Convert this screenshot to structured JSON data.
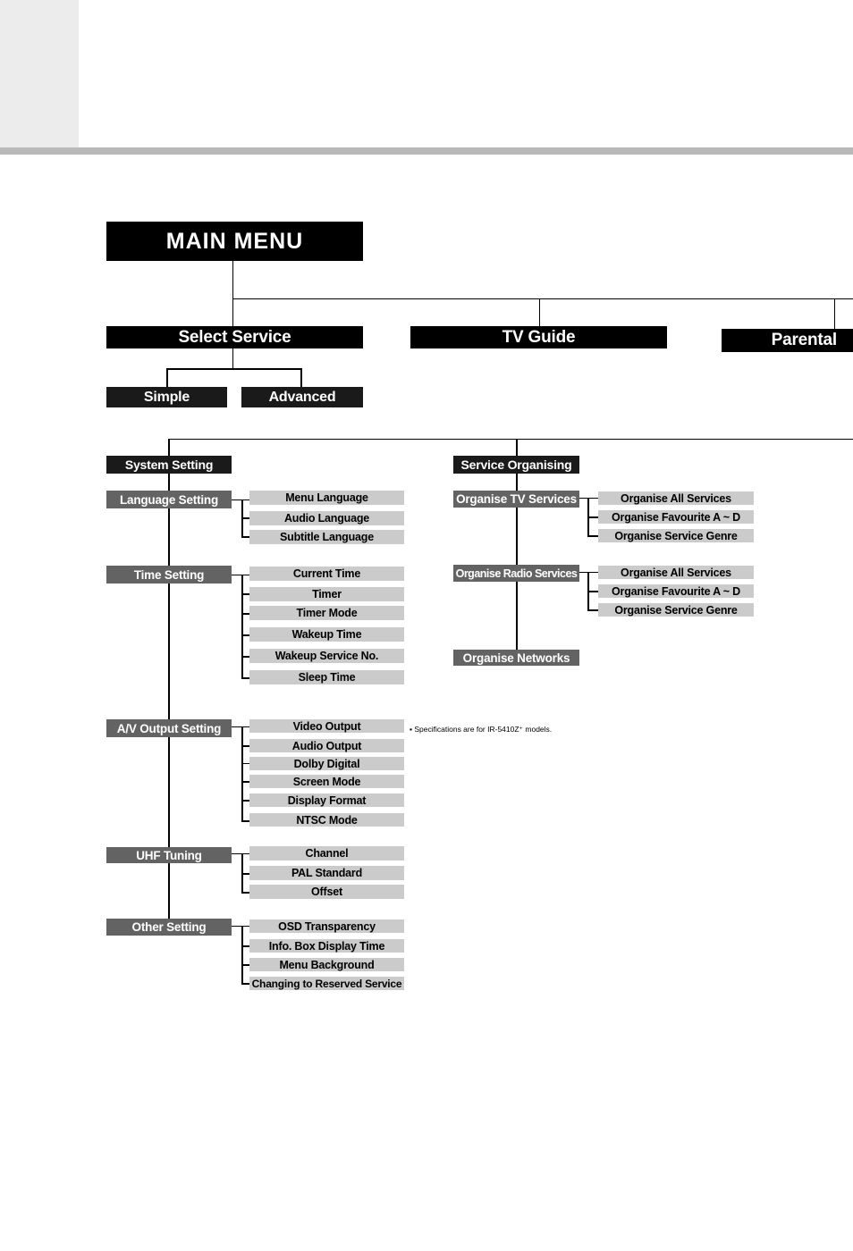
{
  "page": {
    "note": "▪ Specifications are for IR-5410Z⁺ models."
  },
  "tree": {
    "root": "MAIN MENU",
    "top_level": [
      {
        "label": "Select Service",
        "children": [
          "Simple",
          "Advanced"
        ]
      },
      {
        "label": "TV Guide"
      },
      {
        "label": "Parental"
      }
    ],
    "system_setting": {
      "label": "System Setting",
      "groups": [
        {
          "label": "Language Setting",
          "items": [
            "Menu Language",
            "Audio Language",
            "Subtitle Language"
          ]
        },
        {
          "label": "Time Setting",
          "items": [
            "Current Time",
            "Timer",
            "Timer Mode",
            "Wakeup Time",
            "Wakeup Service No.",
            "Sleep Time"
          ]
        },
        {
          "label": "A/V Output Setting",
          "items": [
            "Video Output",
            "Audio Output",
            "Dolby Digital",
            "Screen Mode",
            "Display Format",
            "NTSC Mode"
          ]
        },
        {
          "label": "UHF Tuning",
          "items": [
            "Channel",
            "PAL Standard",
            "Offset"
          ]
        },
        {
          "label": "Other Setting",
          "items": [
            "OSD Transparency",
            "Info. Box Display Time",
            "Menu Background",
            "Changing to Reserved Service"
          ]
        }
      ]
    },
    "service_organising": {
      "label": "Service Organising",
      "groups": [
        {
          "label": "Organise TV Services",
          "items": [
            "Organise All Services",
            "Organise Favourite A ~ D",
            "Organise  Service Genre"
          ]
        },
        {
          "label": "Organise Radio Services",
          "items": [
            "Organise All Services",
            "Organise Favourite A ~ D",
            "Organise  Service Genre"
          ]
        },
        {
          "label": "Organise Networks",
          "items": []
        }
      ]
    }
  }
}
